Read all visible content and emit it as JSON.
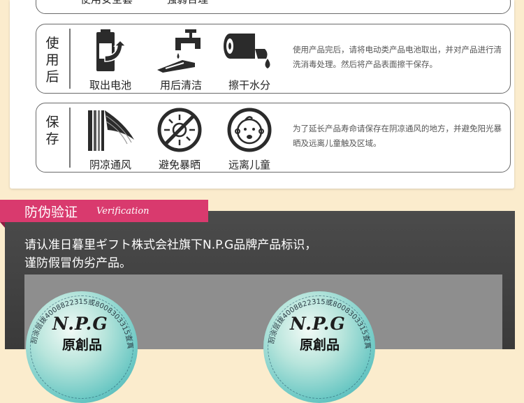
{
  "top_row": {
    "captions": [
      "使用安全套",
      "强弱合理"
    ]
  },
  "after_use": {
    "label": "使用后",
    "items": [
      {
        "icon": "battery-remove-icon",
        "caption": "取出电池"
      },
      {
        "icon": "faucet-clean-icon",
        "caption": "用后清洁"
      },
      {
        "icon": "tissue-roll-icon",
        "caption": "擦干水分"
      }
    ],
    "note": "使用产品完后，请将电动类产品电池取出，并对产品进行清洗消毒处理。然后将产品表面擦干保存。"
  },
  "storage": {
    "label": "保存",
    "items": [
      {
        "icon": "curtain-shade-icon",
        "caption": "阴凉通风"
      },
      {
        "icon": "no-sun-icon",
        "caption": "避免暴晒"
      },
      {
        "icon": "no-child-icon",
        "caption": "远离儿童"
      }
    ],
    "note": "为了延长产品寿命请保存在阴凉通风的地方，并避免阳光暴晒及远离儿童触及区域。"
  },
  "verification": {
    "title": "防伪验证",
    "title_en": "Verification",
    "text_line1": "请认准日暮里ギフト株式会社旗下N.P.G品牌产品标识，",
    "text_line2": "谨防假冒伪劣产品。",
    "seal_logo": "N.P.G",
    "seal_text": "原創品",
    "seal_ring": "刮涂层拨4008822315或8008303315查真伪",
    "colors": {
      "tab": "#d93a6e",
      "panel": "#454545",
      "seal": "#6cc8c4"
    }
  }
}
